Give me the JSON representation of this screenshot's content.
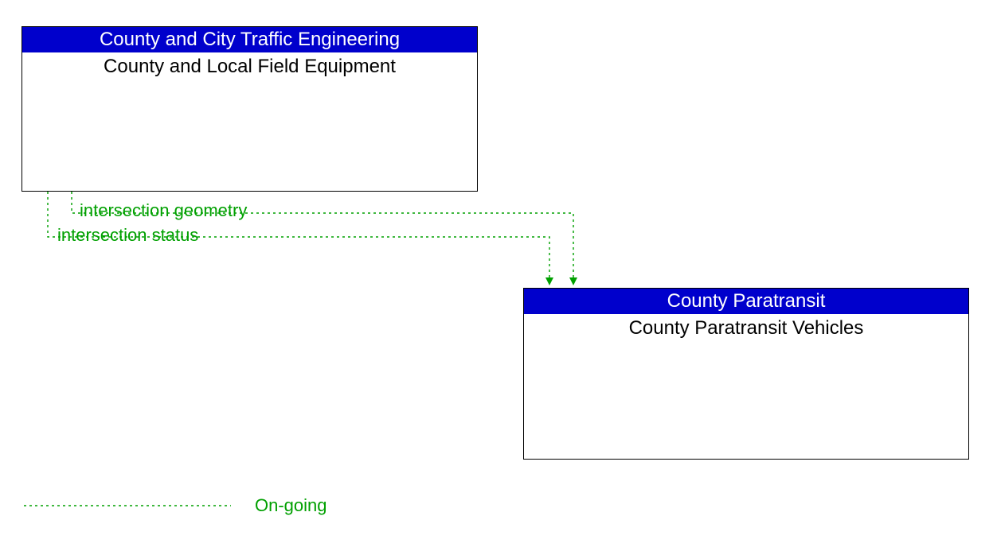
{
  "nodes": {
    "source": {
      "header": "County and City Traffic Engineering",
      "body": "County and Local Field Equipment"
    },
    "target": {
      "header": "County Paratransit",
      "body": "County Paratransit Vehicles"
    }
  },
  "flows": {
    "f1": "intersection geometry",
    "f2": "intersection status"
  },
  "legend": {
    "ongoing": "On-going"
  },
  "colors": {
    "header_bg": "#0000cc",
    "flow": "#00a000"
  }
}
